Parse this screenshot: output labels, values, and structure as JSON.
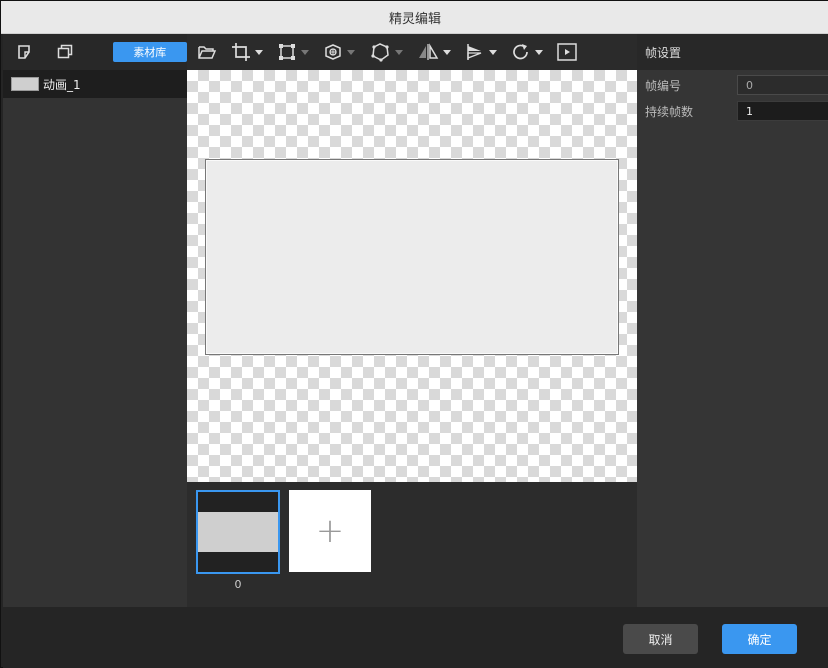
{
  "window": {
    "title": "精灵编辑"
  },
  "left_panel": {
    "toolbar": {
      "new_icon": "new-layer-icon",
      "copy_icon": "duplicate-icon",
      "asset_button": "素材库"
    },
    "animations": [
      {
        "label": "动画_1"
      }
    ]
  },
  "toolbar": {
    "tools": [
      {
        "icon": "open-folder-icon"
      },
      {
        "icon": "crop-icon"
      },
      {
        "icon": "transform-icon"
      },
      {
        "icon": "anchor-icon"
      },
      {
        "icon": "collision-icon"
      },
      {
        "icon": "flip-horizontal-icon"
      },
      {
        "icon": "align-icon"
      },
      {
        "icon": "rotate-icon"
      },
      {
        "icon": "play-icon"
      }
    ]
  },
  "frames": [
    {
      "index": "0"
    }
  ],
  "add_frame_symbol": "+",
  "right_panel": {
    "title": "帧设置",
    "fields": [
      {
        "label": "帧编号",
        "value": "0"
      },
      {
        "label": "持续帧数",
        "value": "1"
      }
    ]
  },
  "footer": {
    "cancel": "取消",
    "ok": "确定"
  },
  "colors": {
    "accent": "#3a97f0",
    "panel": "#333333",
    "toolbar": "#282828"
  }
}
